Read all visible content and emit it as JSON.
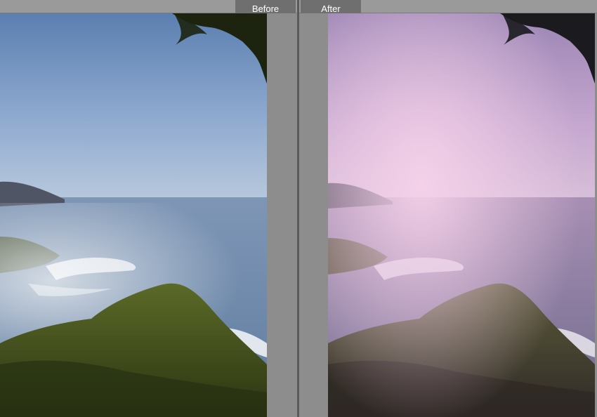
{
  "header": {
    "before_label": "Before",
    "after_label": "After"
  },
  "colors": {
    "chrome_bg": "#8c8c8c",
    "label_bg": "#6f6f6f",
    "label_text": "#ffffff",
    "sky_top": "#5f82b2",
    "sky_horizon": "#a9bfd8",
    "fog": "#c7cfdb",
    "hill": "#4a5a20",
    "after_tint": "#f1c6e3"
  }
}
